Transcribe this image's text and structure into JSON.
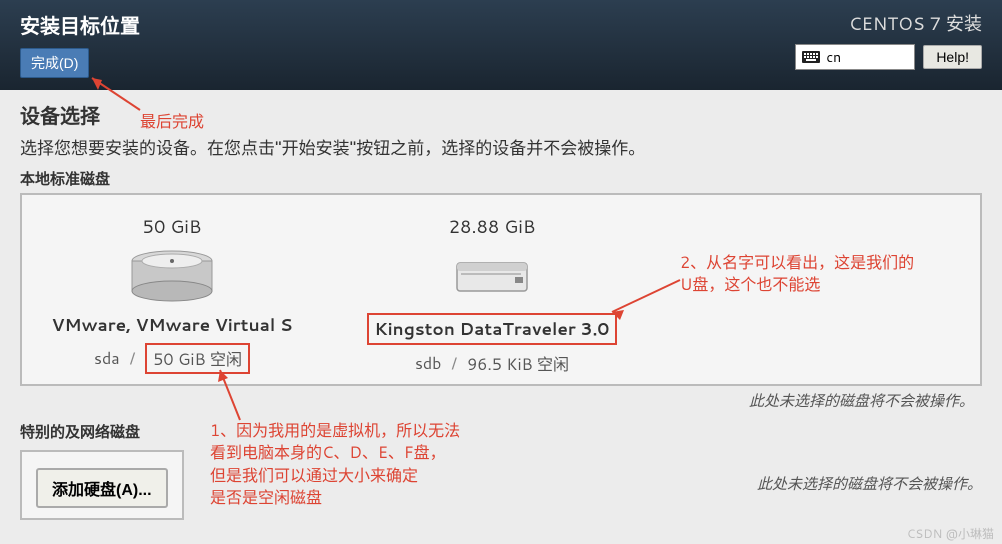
{
  "header": {
    "page_title": "安装目标位置",
    "done_label": "完成(D)",
    "installer_title": "CENTOS 7 安装",
    "lang_code": "cn",
    "help_label": "Help!"
  },
  "device_selection": {
    "title": "设备选择",
    "description": "选择您想要安装的设备。在您点击\"开始安装\"按钮之前，选择的设备并不会被操作。"
  },
  "local_disks": {
    "label": "本地标准磁盘",
    "items": [
      {
        "size": "50 GiB",
        "name": "VMware, VMware Virtual S",
        "dev": "sda",
        "free": "50 GiB 空闲"
      },
      {
        "size": "28.88 GiB",
        "name": "Kingston DataTraveler 3.0",
        "dev": "sdb",
        "free": "96.5 KiB 空闲"
      }
    ],
    "hint": "此处未选择的磁盘将不会被操作。"
  },
  "special_disks": {
    "label": "特别的及网络磁盘",
    "add_label": "添加硬盘(A)...",
    "hint": "此处未选择的磁盘将不会被操作。"
  },
  "annotations": {
    "a_done": "最后完成",
    "a1": "1、因为我用的是虚拟机，所以无法\n看到电脑本身的C、D、E、F盘，\n但是我们可以通过大小来确定\n是否是空闲磁盘",
    "a2": "2、从名字可以看出，这是我们的\nU盘，这个也不能选"
  },
  "watermark": "CSDN @小琳猫"
}
